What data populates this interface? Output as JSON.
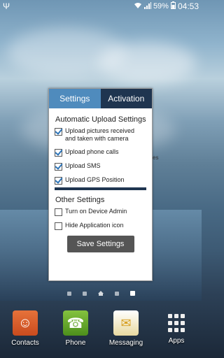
{
  "status_bar": {
    "battery": "59%",
    "time": "04:53"
  },
  "dialog": {
    "tabs": [
      {
        "label": "Settings"
      },
      {
        "label": "Activation"
      }
    ],
    "automatic_title": "Automatic Upload Settings",
    "automatic_items": [
      {
        "label": "Upload pictures received and taken with camera",
        "checked": true
      },
      {
        "label": "Upload phone calls",
        "checked": true
      },
      {
        "label": "Upload SMS",
        "checked": true
      },
      {
        "label": "Upload GPS Position",
        "checked": true
      }
    ],
    "other_title": "Other Settings",
    "other_items": [
      {
        "label": "Turn on Device Admin",
        "checked": false
      },
      {
        "label": "Hide Application icon",
        "checked": false
      }
    ],
    "save_label": "Save Settings"
  },
  "behind_text": "es",
  "dock": {
    "items": [
      {
        "label": "Contacts",
        "icon": "contacts-icon"
      },
      {
        "label": "Phone",
        "icon": "phone-icon"
      },
      {
        "label": "Messaging",
        "icon": "messaging-icon"
      },
      {
        "label": "Apps",
        "icon": "apps-grid-icon"
      }
    ]
  }
}
